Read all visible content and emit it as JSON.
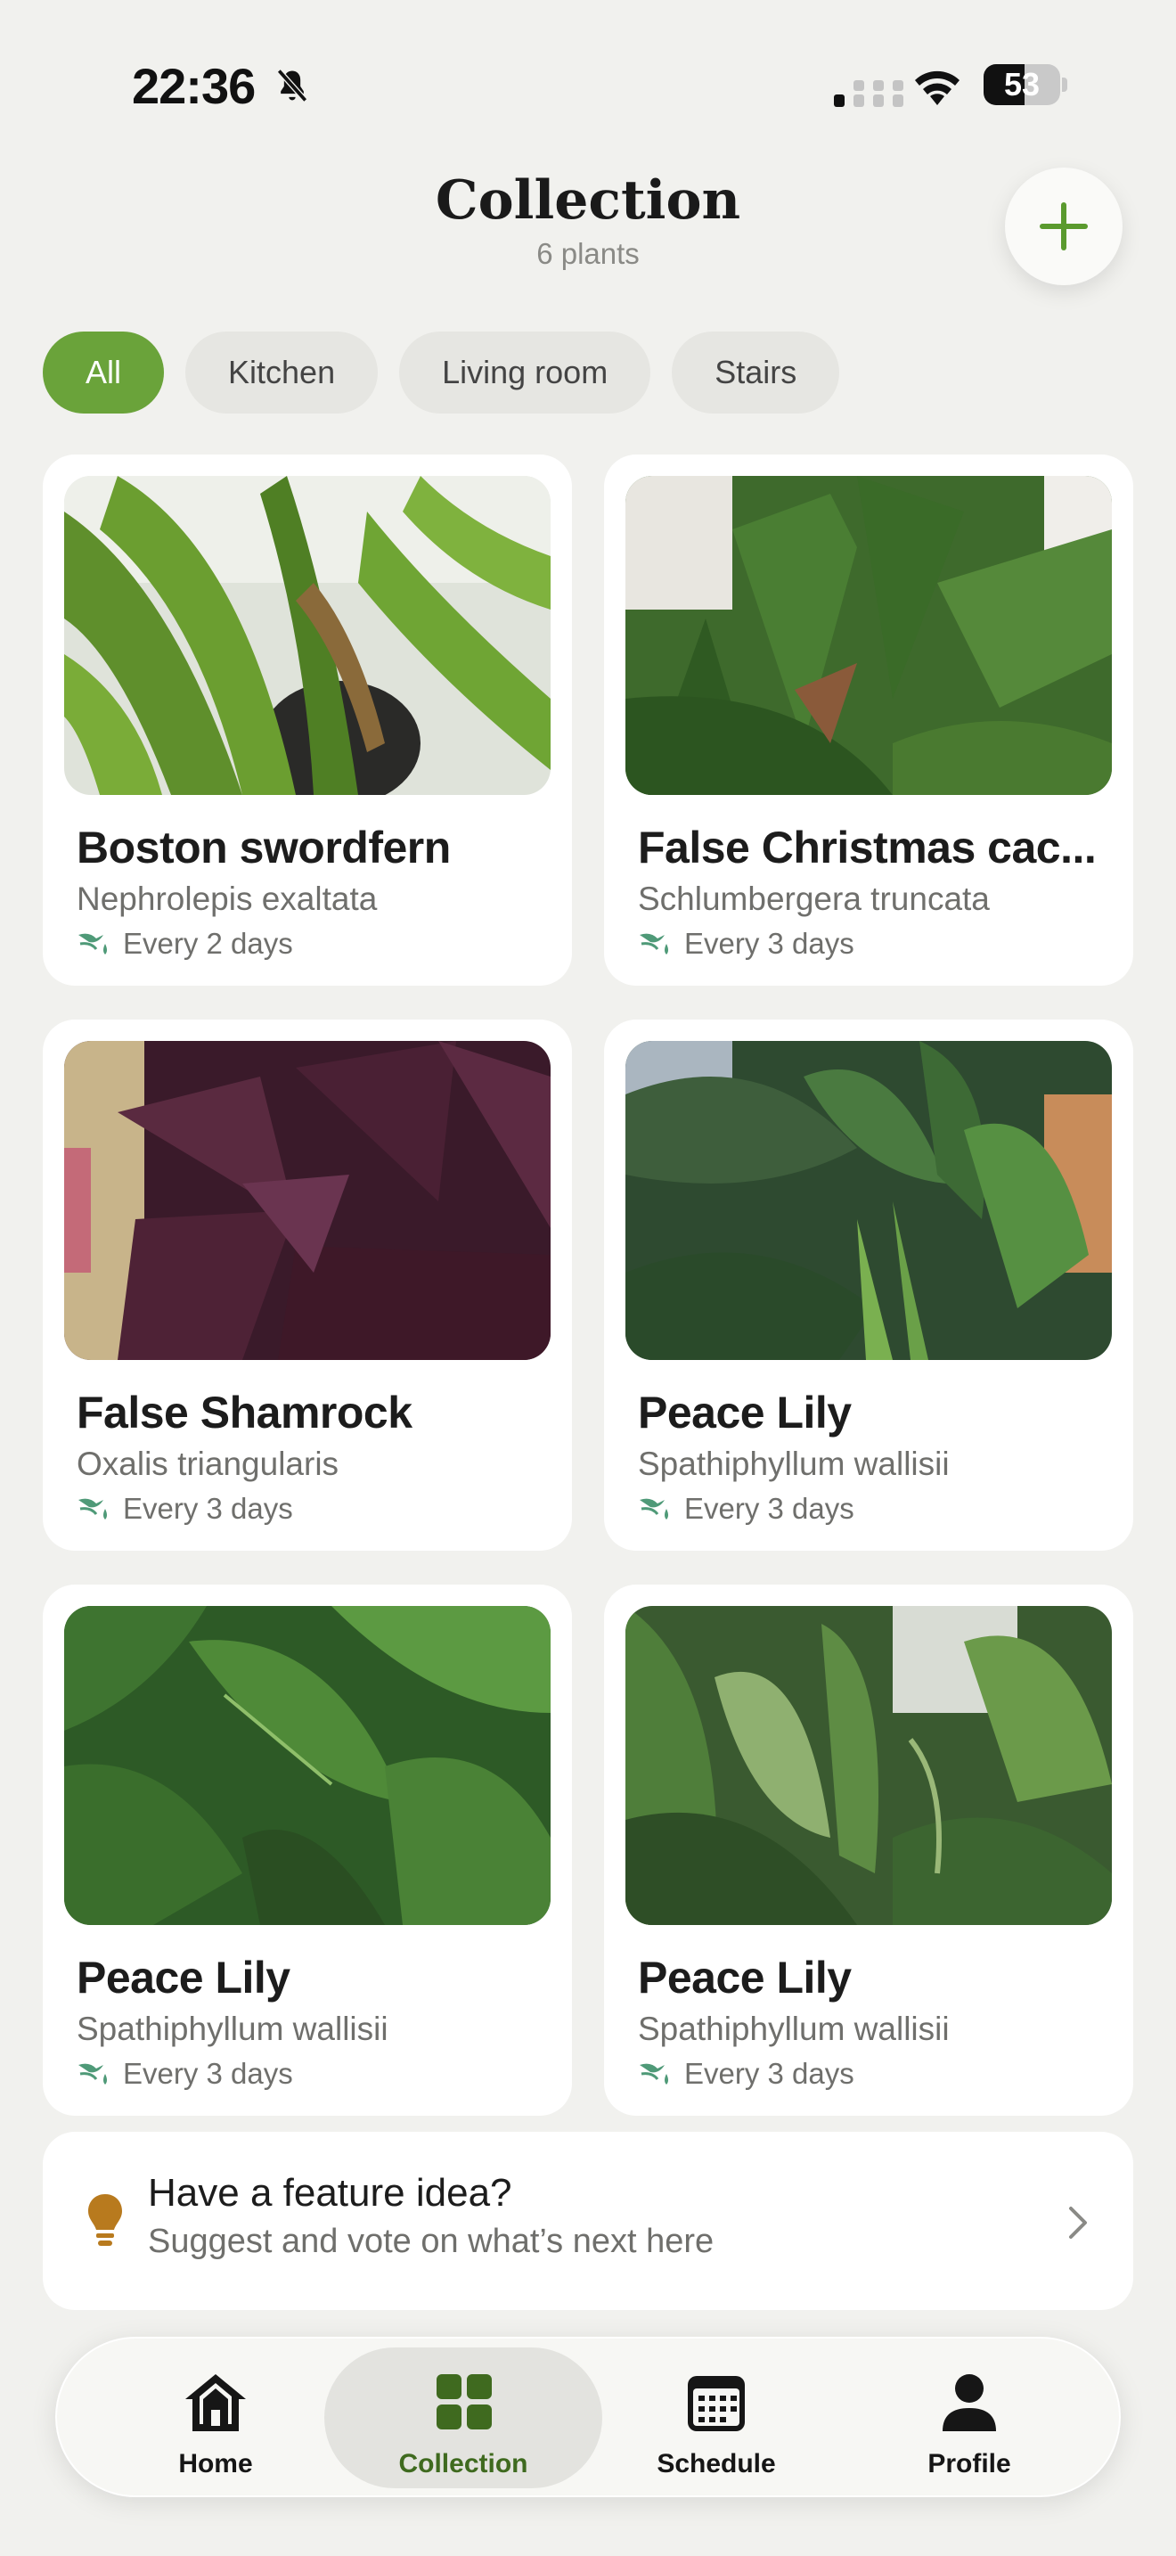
{
  "status_bar": {
    "time": "22:36",
    "battery": "53",
    "battery_level": 0.53
  },
  "header": {
    "title": "Collection",
    "subtitle": "6 plants",
    "add_icon": "plus-icon"
  },
  "filters": [
    {
      "label": "All",
      "active": true
    },
    {
      "label": "Kitchen",
      "active": false
    },
    {
      "label": "Living room",
      "active": false
    },
    {
      "label": "Stairs",
      "active": false
    }
  ],
  "plants": [
    {
      "name": "Boston swordfern",
      "scientific": "Nephrolepis exaltata",
      "watering": "Every 2 days",
      "photo": "fern"
    },
    {
      "name": "False Christmas cac...",
      "scientific": "Schlumbergera truncata",
      "watering": "Every 3 days",
      "photo": "cactus"
    },
    {
      "name": "False Shamrock",
      "scientific": "Oxalis triangularis",
      "watering": "Every 3 days",
      "photo": "shamrock"
    },
    {
      "name": "Peace Lily",
      "scientific": "Spathiphyllum wallisii",
      "watering": "Every 3 days",
      "photo": "lily"
    },
    {
      "name": "Peace Lily",
      "scientific": "Spathiphyllum wallisii",
      "watering": "Every 3 days",
      "photo": "lily2"
    },
    {
      "name": "Peace Lily",
      "scientific": "Spathiphyllum wallisii",
      "watering": "Every 3 days",
      "photo": "lily3"
    }
  ],
  "feature_card": {
    "title": "Have a feature idea?",
    "subtitle": "Suggest and vote on what’s next here",
    "icon": "lightbulb-icon"
  },
  "tabs": [
    {
      "label": "Home",
      "icon": "house-icon",
      "active": false
    },
    {
      "label": "Collection",
      "icon": "grid-icon",
      "active": true
    },
    {
      "label": "Schedule",
      "icon": "calendar-icon",
      "active": false
    },
    {
      "label": "Profile",
      "icon": "person-icon",
      "active": false
    }
  ],
  "colors": {
    "accent": "#6aa33a",
    "accent_dark": "#3f6a1f",
    "water_icon": "#4f9a78",
    "bulb": "#b87a1e"
  }
}
